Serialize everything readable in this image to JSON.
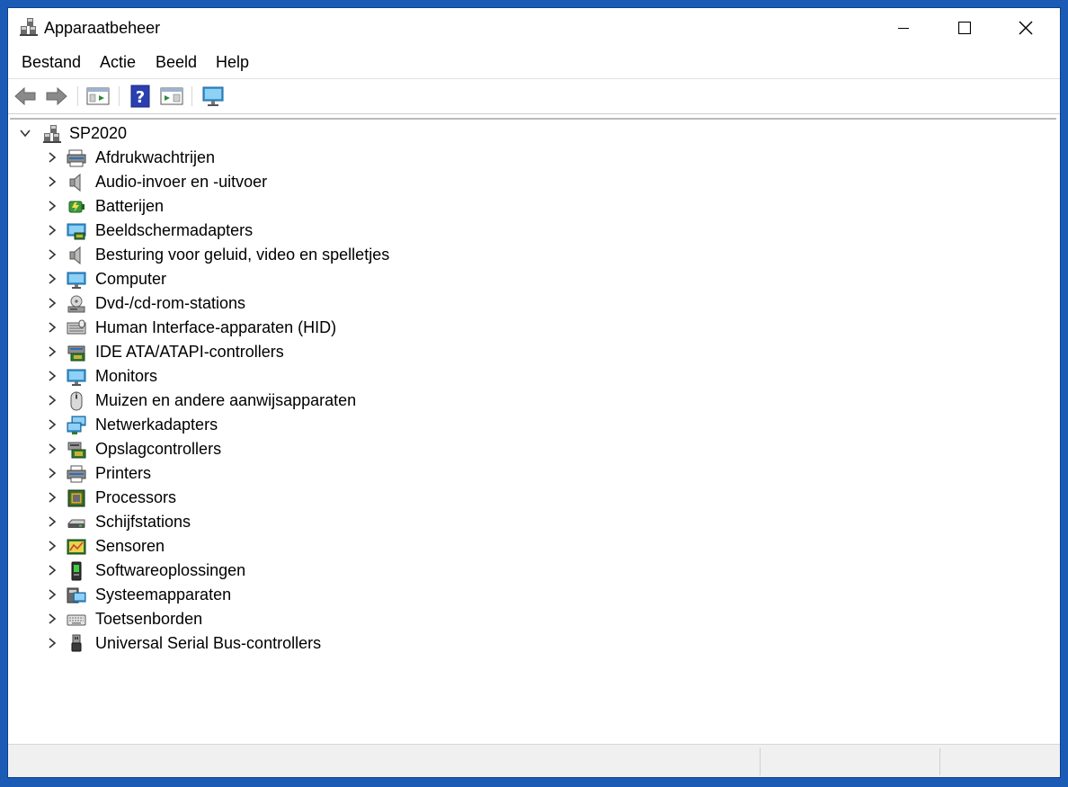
{
  "window": {
    "title": "Apparaatbeheer",
    "controls": [
      "minimize",
      "maximize",
      "close"
    ]
  },
  "menu": {
    "items": [
      {
        "label": "Bestand"
      },
      {
        "label": "Actie"
      },
      {
        "label": "Beeld"
      },
      {
        "label": "Help"
      }
    ]
  },
  "toolbar": {
    "buttons": [
      {
        "icon": "back-arrow-icon"
      },
      {
        "icon": "forward-arrow-icon"
      },
      {
        "icon": "properties-icon"
      },
      {
        "icon": "help-icon"
      },
      {
        "icon": "action-pane-icon"
      },
      {
        "icon": "scan-hardware-icon"
      }
    ]
  },
  "tree": {
    "root": {
      "label": "SP2020",
      "expanded": true,
      "icon": "computer-network-icon"
    },
    "items": [
      {
        "label": "Afdrukwachtrijen",
        "icon": "printer-queue-icon"
      },
      {
        "label": "Audio-invoer en -uitvoer",
        "icon": "speaker-icon"
      },
      {
        "label": "Batterijen",
        "icon": "battery-icon"
      },
      {
        "label": "Beeldschermadapters",
        "icon": "display-adapter-icon"
      },
      {
        "label": "Besturing voor geluid, video en spelletjes",
        "icon": "speaker-icon"
      },
      {
        "label": "Computer",
        "icon": "monitor-icon"
      },
      {
        "label": "Dvd-/cd-rom-stations",
        "icon": "disc-drive-icon"
      },
      {
        "label": "Human Interface-apparaten (HID)",
        "icon": "hid-icon"
      },
      {
        "label": "IDE ATA/ATAPI-controllers",
        "icon": "ide-controller-icon"
      },
      {
        "label": "Monitors",
        "icon": "monitor-icon"
      },
      {
        "label": "Muizen en andere aanwijsapparaten",
        "icon": "mouse-icon"
      },
      {
        "label": "Netwerkadapters",
        "icon": "network-adapter-icon"
      },
      {
        "label": "Opslagcontrollers",
        "icon": "storage-controller-icon"
      },
      {
        "label": "Printers",
        "icon": "printer-icon"
      },
      {
        "label": "Processors",
        "icon": "processor-icon"
      },
      {
        "label": "Schijfstations",
        "icon": "disk-drive-icon"
      },
      {
        "label": "Sensoren",
        "icon": "sensor-icon"
      },
      {
        "label": "Softwareoplossingen",
        "icon": "software-component-icon"
      },
      {
        "label": "Systeemapparaten",
        "icon": "system-devices-icon"
      },
      {
        "label": "Toetsenborden",
        "icon": "keyboard-icon"
      },
      {
        "label": "Universal Serial Bus-controllers",
        "icon": "usb-icon"
      }
    ]
  },
  "colors": {
    "desktop": "#1c5bb5",
    "window_bg": "#ffffff",
    "statusbar_bg": "#f0f0f0"
  }
}
